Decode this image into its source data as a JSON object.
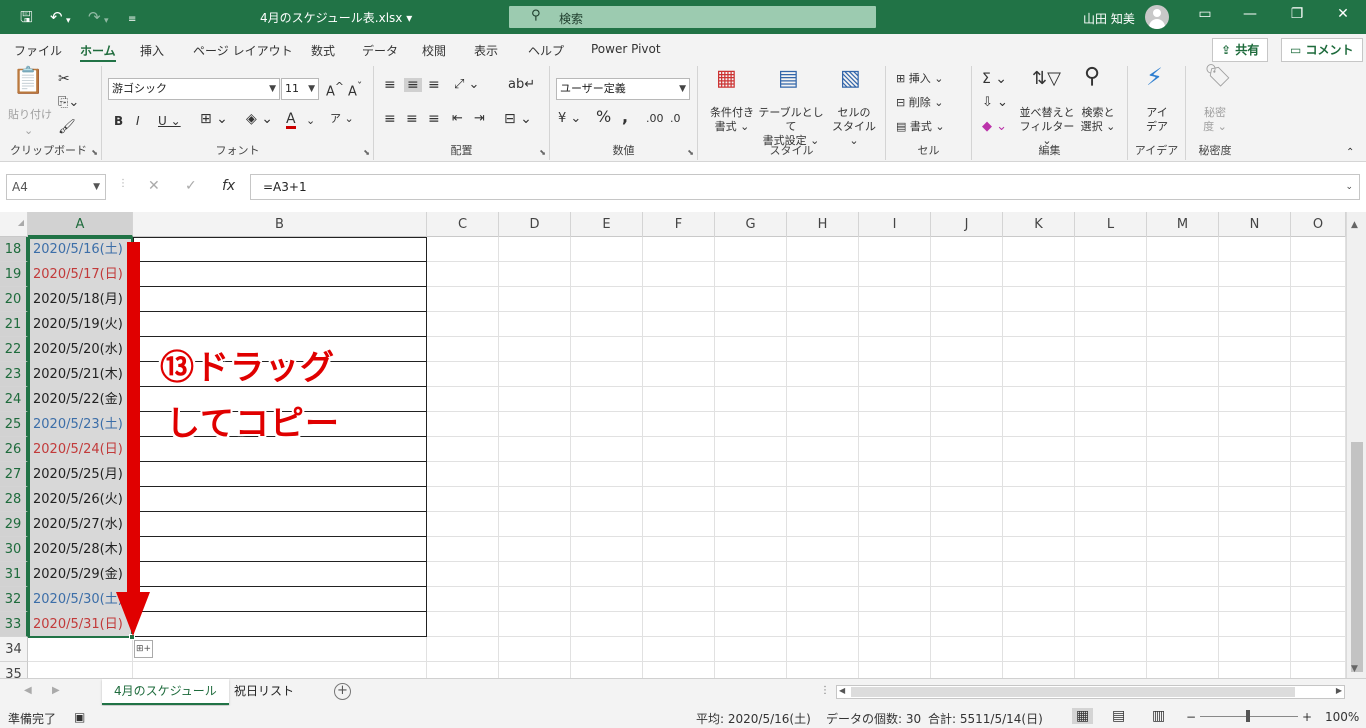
{
  "window": {
    "filename": "4月のスケジュール表.xlsx",
    "search_placeholder": "検索",
    "user": "山田 知美"
  },
  "ribbon_tabs": [
    "ファイル",
    "ホーム",
    "挿入",
    "ページ レイアウト",
    "数式",
    "データ",
    "校閲",
    "表示",
    "ヘルプ",
    "Power Pivot"
  ],
  "share_label": "共有",
  "comment_label": "コメント",
  "ribbon": {
    "clipboard": {
      "paste": "貼り付け",
      "label": "クリップボード"
    },
    "font": {
      "name": "游ゴシック",
      "size": "11",
      "label": "フォント"
    },
    "align": {
      "label": "配置"
    },
    "number": {
      "format": "ユーザー定義",
      "label": "数値"
    },
    "styles": {
      "cond": "条件付き",
      "cond2": "書式",
      "table": "テーブルとして",
      "table2": "書式設定",
      "cell": "セルの",
      "cell2": "スタイル",
      "label": "スタイル"
    },
    "cells": {
      "insert": "挿入",
      "delete": "削除",
      "format": "書式",
      "label": "セル"
    },
    "edit": {
      "sort": "並べ替えと",
      "sort2": "フィルター",
      "find": "検索と",
      "find2": "選択",
      "label": "編集"
    },
    "ideas": {
      "l1": "アイ",
      "l2": "デア",
      "label": "アイデア"
    },
    "sens": {
      "l1": "秘密",
      "l2": "度",
      "label": "秘密度"
    }
  },
  "namebox": "A4",
  "formula": "=A3+1",
  "accent": "#217346",
  "columns": [
    "A",
    "B",
    "C",
    "D",
    "E",
    "F",
    "G",
    "H",
    "I",
    "J",
    "K",
    "L",
    "M",
    "N",
    "O"
  ],
  "rows": [
    {
      "num": "18",
      "a": "2020/5/16(土)",
      "kind": "sat"
    },
    {
      "num": "19",
      "a": "2020/5/17(日)",
      "kind": "sun"
    },
    {
      "num": "20",
      "a": "2020/5/18(月)",
      "kind": "wd"
    },
    {
      "num": "21",
      "a": "2020/5/19(火)",
      "kind": "wd"
    },
    {
      "num": "22",
      "a": "2020/5/20(水)",
      "kind": "wd"
    },
    {
      "num": "23",
      "a": "2020/5/21(木)",
      "kind": "wd"
    },
    {
      "num": "24",
      "a": "2020/5/22(金)",
      "kind": "wd"
    },
    {
      "num": "25",
      "a": "2020/5/23(土)",
      "kind": "sat"
    },
    {
      "num": "26",
      "a": "2020/5/24(日)",
      "kind": "sun"
    },
    {
      "num": "27",
      "a": "2020/5/25(月)",
      "kind": "wd"
    },
    {
      "num": "28",
      "a": "2020/5/26(火)",
      "kind": "wd"
    },
    {
      "num": "29",
      "a": "2020/5/27(水)",
      "kind": "wd"
    },
    {
      "num": "30",
      "a": "2020/5/28(木)",
      "kind": "wd"
    },
    {
      "num": "31",
      "a": "2020/5/29(金)",
      "kind": "wd"
    },
    {
      "num": "32",
      "a": "2020/5/30(土)",
      "kind": "sat"
    },
    {
      "num": "33",
      "a": "2020/5/31(日)",
      "kind": "sun"
    },
    {
      "num": "34",
      "a": "",
      "kind": "empty"
    },
    {
      "num": "35",
      "a": "",
      "kind": "empty"
    }
  ],
  "annotation": {
    "line1": "⑬ドラッグ",
    "line2": "してコピー"
  },
  "sheets": [
    "4月のスケジュール",
    "祝日リスト"
  ],
  "status": {
    "ready": "準備完了",
    "average": "平均: 2020/5/16(土)",
    "count": "データの個数: 30",
    "sum": "合計: 5511/5/14(日)",
    "zoom": "100%"
  },
  "colors": {
    "saturday": "#3c6ea8",
    "sunday": "#c23a3a",
    "weekday": "#222222",
    "annotation": "#e00000"
  }
}
